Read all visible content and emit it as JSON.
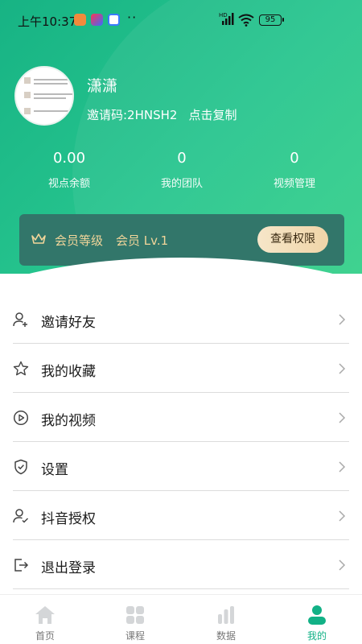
{
  "status_bar": {
    "time": "上午10:37",
    "network": "HD",
    "battery": "95"
  },
  "profile": {
    "username": "潇潇",
    "invite_code": "邀请码:2HNSH2",
    "copy_label": "点击复制"
  },
  "stats": [
    {
      "value": "0.00",
      "label": "视点余额"
    },
    {
      "value": "0",
      "label": "我的团队"
    },
    {
      "value": "0",
      "label": "视频管理"
    }
  ],
  "membership": {
    "level_label": "会员等级",
    "level_value": "会员 Lv.1",
    "view_rights_label": "查看权限"
  },
  "menu": {
    "items": [
      {
        "label": "邀请好友",
        "icon": "add-user-icon"
      },
      {
        "label": "我的收藏",
        "icon": "star-icon"
      },
      {
        "label": "我的视频",
        "icon": "play-circle-icon"
      },
      {
        "label": "设置",
        "icon": "shield-check-icon"
      },
      {
        "label": "抖音授权",
        "icon": "user-check-icon"
      },
      {
        "label": "退出登录",
        "icon": "logout-icon"
      }
    ]
  },
  "tabbar": {
    "tabs": [
      {
        "label": "首页",
        "icon": "home-icon"
      },
      {
        "label": "课程",
        "icon": "grid-icon"
      },
      {
        "label": "数据",
        "icon": "bar-chart-icon"
      },
      {
        "label": "我的",
        "icon": "person-icon"
      }
    ],
    "active_index": 3
  },
  "colors": {
    "accent": "#12b186",
    "gradient_start": "#17b384",
    "gradient_end": "#34d08a",
    "member_card": "#32766a",
    "gold_text": "#f1d59a"
  }
}
